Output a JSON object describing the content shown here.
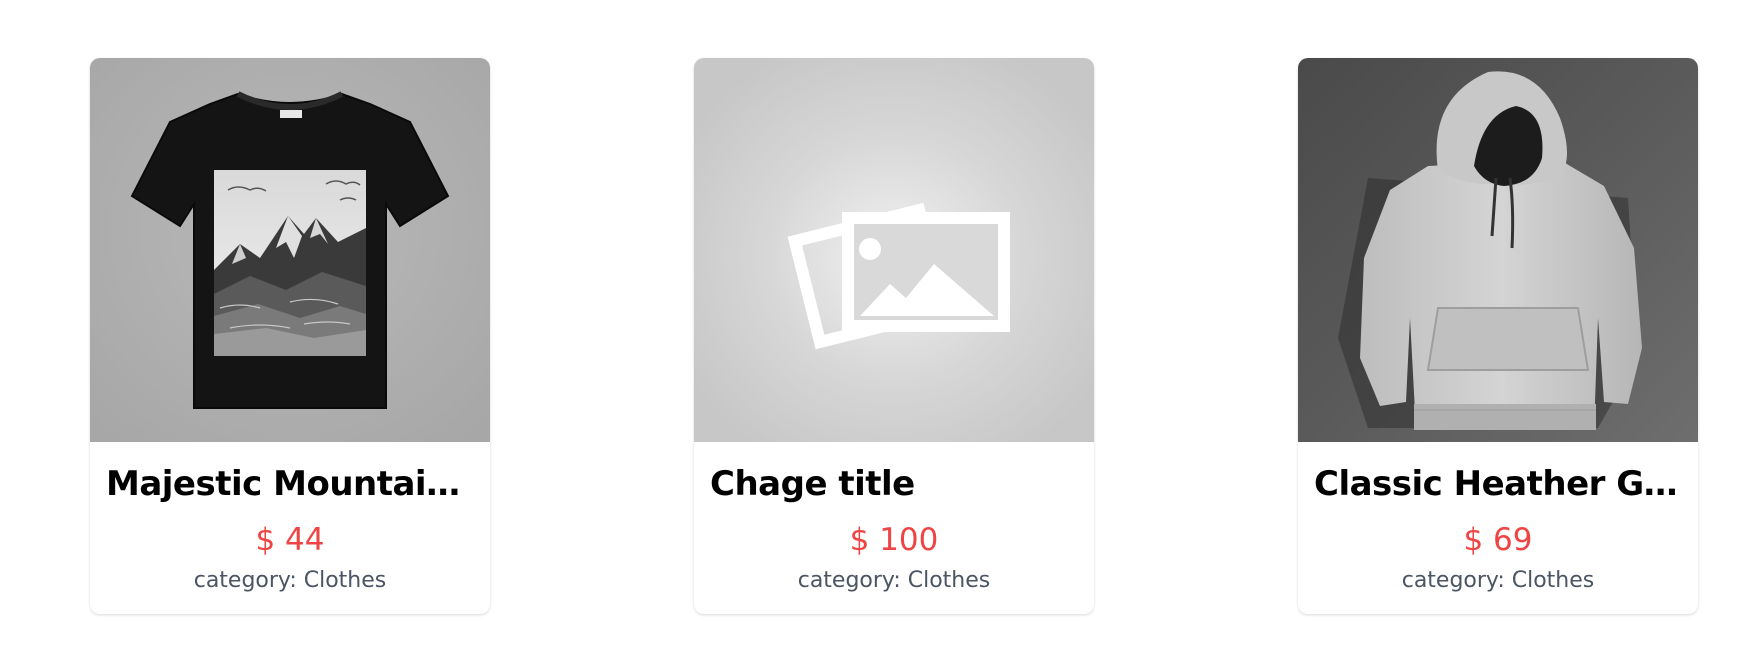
{
  "currency_symbol": "$",
  "colors": {
    "price": "#ef4444",
    "category_text": "#4b5563",
    "title_text": "#000000",
    "card_bg": "#ffffff"
  },
  "products": [
    {
      "title": "Majestic Mountain Graphic T-Shirt",
      "price_display": "$ 44",
      "category_display": "category: Clothes",
      "image": "black-tshirt-mountain-print"
    },
    {
      "title": "Chage title",
      "price_display": "$ 100",
      "category_display": "category: Clothes",
      "image": "image-placeholder-icon"
    },
    {
      "title": "Classic Heather Gray Hoodie",
      "price_display": "$ 69",
      "category_display": "category: Clothes",
      "image": "gray-hoodie"
    }
  ]
}
